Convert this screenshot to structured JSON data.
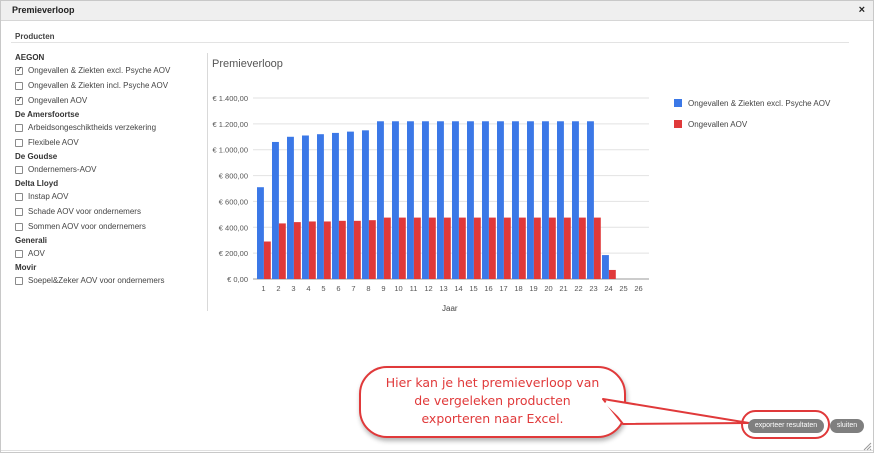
{
  "dialog": {
    "title": "Premieverloop",
    "close_icon": "×"
  },
  "products": {
    "section_label": "Producten",
    "groups": [
      {
        "name": "AEGON",
        "items": [
          {
            "label": "Ongevallen & Ziekten excl. Psyche AOV",
            "checked": true
          },
          {
            "label": "Ongevallen & Ziekten incl. Psyche AOV",
            "checked": false
          },
          {
            "label": "Ongevallen AOV",
            "checked": true
          }
        ]
      },
      {
        "name": "De Amersfoortse",
        "items": [
          {
            "label": "Arbeidsongeschiktheids verzekering",
            "checked": false
          },
          {
            "label": "Flexibele AOV",
            "checked": false
          }
        ]
      },
      {
        "name": "De Goudse",
        "items": [
          {
            "label": "Ondernemers-AOV",
            "checked": false
          }
        ]
      },
      {
        "name": "Delta Lloyd",
        "items": [
          {
            "label": "Instap AOV",
            "checked": false
          },
          {
            "label": "Schade AOV voor ondernemers",
            "checked": false
          },
          {
            "label": "Sommen AOV voor ondernemers",
            "checked": false
          }
        ]
      },
      {
        "name": "Generali",
        "items": [
          {
            "label": "AOV",
            "checked": false
          }
        ]
      },
      {
        "name": "Movir",
        "items": [
          {
            "label": "Soepel&Zeker AOV voor ondernemers",
            "checked": false
          }
        ]
      }
    ]
  },
  "chart_data": {
    "type": "bar",
    "title": "Premieverloop",
    "xlabel": "Jaar",
    "ylabel": "",
    "ylim": [
      0,
      1400
    ],
    "yticks": [
      "€ 0,00",
      "€ 200,00",
      "€ 400,00",
      "€ 600,00",
      "€ 800,00",
      "€ 1.000,00",
      "€ 1.200,00",
      "€ 1.400,00"
    ],
    "ytick_values": [
      0,
      200,
      400,
      600,
      800,
      1000,
      1200,
      1400
    ],
    "categories": [
      "1",
      "2",
      "3",
      "4",
      "5",
      "6",
      "7",
      "8",
      "9",
      "10",
      "11",
      "12",
      "13",
      "14",
      "15",
      "16",
      "17",
      "18",
      "19",
      "20",
      "21",
      "22",
      "23",
      "24",
      "25",
      "26"
    ],
    "series": [
      {
        "name": "Ongevallen & Ziekten excl. Psyche AOV",
        "color": "#3b78e7",
        "values": [
          710,
          1060,
          1100,
          1110,
          1120,
          1130,
          1140,
          1150,
          1220,
          1220,
          1220,
          1220,
          1220,
          1220,
          1220,
          1220,
          1220,
          1220,
          1220,
          1220,
          1220,
          1220,
          1220,
          185,
          0,
          0
        ]
      },
      {
        "name": "Ongevallen AOV",
        "color": "#e0393a",
        "values": [
          290,
          430,
          440,
          445,
          445,
          450,
          450,
          455,
          475,
          475,
          475,
          475,
          475,
          475,
          475,
          475,
          475,
          475,
          475,
          475,
          475,
          475,
          475,
          70,
          0,
          0
        ]
      }
    ],
    "legend": "right",
    "grid": true
  },
  "callout": {
    "line1": "Hier kan je het premieverloop van",
    "line2": "de vergeleken producten",
    "line3": "exporteren naar Excel."
  },
  "buttons": {
    "export": "exporteer resultaten",
    "close": "sluiten"
  }
}
